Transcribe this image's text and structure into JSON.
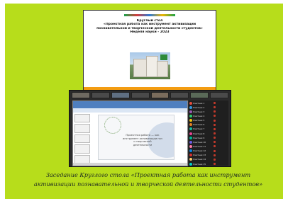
{
  "slide": {
    "lines": [
      "Круглый стол",
      "«Проектная работа как инструмент активизации",
      "познавательной и творческой деятельности студентов»",
      "Неделя науки - 2023"
    ]
  },
  "presentation": {
    "slide_text": [
      "Проектная работа — как",
      "инструмент активизации познавательной",
      "и творческой",
      "деятельности"
    ]
  },
  "participants": [
    {
      "name": "Участник 1",
      "color": "#e74c3c"
    },
    {
      "name": "Участник 2",
      "color": "#3498db"
    },
    {
      "name": "Участник 3",
      "color": "#9b59b6"
    },
    {
      "name": "Участник 4",
      "color": "#2ecc71"
    },
    {
      "name": "Участник 5",
      "color": "#f1c40f"
    },
    {
      "name": "Участник 6",
      "color": "#e67e22"
    },
    {
      "name": "Участник 7",
      "color": "#1abc9c"
    },
    {
      "name": "Участник 8",
      "color": "#e84393"
    },
    {
      "name": "Участник 9",
      "color": "#00b894"
    },
    {
      "name": "Участник 10",
      "color": "#6c5ce7"
    },
    {
      "name": "Участник 11",
      "color": "#fd79a8"
    },
    {
      "name": "Участник 12",
      "color": "#0984e3"
    },
    {
      "name": "Участник 13",
      "color": "#d63031"
    },
    {
      "name": "Участник 14",
      "color": "#fdcb6e"
    },
    {
      "name": "Участник 15",
      "color": "#00cec9"
    }
  ],
  "caption": {
    "line1": "Заседание Круглого стола «Проектная работа как инструмент",
    "line2": "активизации познавательной и творческой деятельности студентов»"
  },
  "colors": {
    "background": "#b7dd1b",
    "accent": "#f39c12"
  }
}
